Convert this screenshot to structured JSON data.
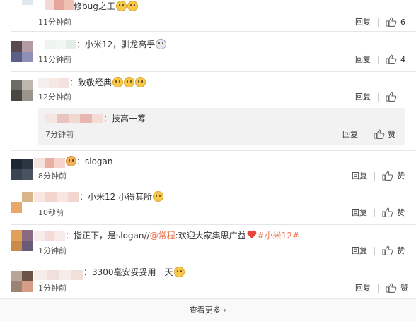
{
  "comments": [
    {
      "text": "修bug之王",
      "time": "11分钟前",
      "reply_label": "回复",
      "likes": "6"
    },
    {
      "text": "：小米12，驯龙高手",
      "time": "11分钟前",
      "reply_label": "回复",
      "likes": "4"
    },
    {
      "text": "：致敬经典",
      "time": "12分钟前",
      "reply_label": "回复",
      "likes": "",
      "subreply": {
        "text": "：技高一筹",
        "time": "7分钟前",
        "reply_label": "回复",
        "like_label": "赞"
      }
    },
    {
      "text": "：slogan",
      "time": "8分钟前",
      "reply_label": "回复",
      "like_label": "赞"
    },
    {
      "text": "：小米12 小得其所",
      "time": "10秒前",
      "reply_label": "回复",
      "like_label": "赞"
    },
    {
      "text_prefix": "：指正下，是slogan//",
      "mention": "@常程",
      "text_middle": ":欢迎大家集思广益",
      "topic": "#小米12#",
      "time": "1分钟前",
      "reply_label": "回复",
      "like_label": "赞"
    },
    {
      "text": "：3300毫安妥妥用一天",
      "time": "1分钟前",
      "reply_label": "回复",
      "like_label": "赞"
    }
  ],
  "footer": {
    "more_label": "查看更多"
  },
  "colors": {
    "mention": "#eb7350",
    "background": "#ffffff",
    "subreply_bg": "#f2f2f2"
  }
}
